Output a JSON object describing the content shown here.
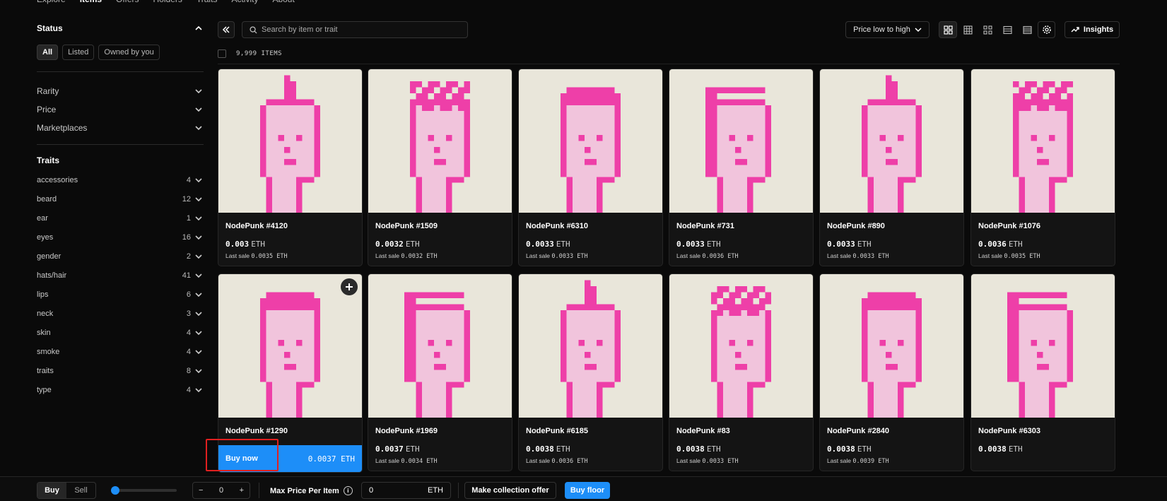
{
  "nav": {
    "tabs": [
      "Explore",
      "Items",
      "Offers",
      "Holders",
      "Traits",
      "Activity",
      "About"
    ],
    "active": "Items"
  },
  "sidebar": {
    "status": {
      "title": "Status",
      "buttons": [
        "All",
        "Listed",
        "Owned by you"
      ],
      "active": "All"
    },
    "filters": [
      "Rarity",
      "Price",
      "Marketplaces"
    ],
    "traits_title": "Traits",
    "traits": [
      {
        "name": "accessories",
        "count": "4"
      },
      {
        "name": "beard",
        "count": "12"
      },
      {
        "name": "ear",
        "count": "1"
      },
      {
        "name": "eyes",
        "count": "16"
      },
      {
        "name": "gender",
        "count": "2"
      },
      {
        "name": "hats/hair",
        "count": "41"
      },
      {
        "name": "lips",
        "count": "6"
      },
      {
        "name": "neck",
        "count": "3"
      },
      {
        "name": "skin",
        "count": "4"
      },
      {
        "name": "smoke",
        "count": "4"
      },
      {
        "name": "traits",
        "count": "8"
      },
      {
        "name": "type",
        "count": "4"
      }
    ]
  },
  "toolbar": {
    "search_placeholder": "Search by item or trait",
    "sort_label": "Price low to high",
    "insights_label": "Insights",
    "item_count": "9,999 ITEMS",
    "view_icons": [
      "grid-large-icon",
      "grid-small-icon",
      "grid-compact-icon",
      "list-icon",
      "table-icon"
    ]
  },
  "items": [
    {
      "name": "NodePunk #4120",
      "price": "0.003",
      "unit": "ETH",
      "last_sale": "Last sale",
      "last_value": "0.0035 ETH"
    },
    {
      "name": "NodePunk #1509",
      "price": "0.0032",
      "unit": "ETH",
      "last_sale": "Last sale",
      "last_value": "0.0032 ETH"
    },
    {
      "name": "NodePunk #6310",
      "price": "0.0033",
      "unit": "ETH",
      "last_sale": "Last sale",
      "last_value": "0.0033 ETH"
    },
    {
      "name": "NodePunk #731",
      "price": "0.0033",
      "unit": "ETH",
      "last_sale": "Last sale",
      "last_value": "0.0036 ETH"
    },
    {
      "name": "NodePunk #890",
      "price": "0.0033",
      "unit": "ETH",
      "last_sale": "Last sale",
      "last_value": "0.0033 ETH"
    },
    {
      "name": "NodePunk #1076",
      "price": "0.0036",
      "unit": "ETH",
      "last_sale": "Last sale",
      "last_value": "0.0035 ETH"
    },
    {
      "name": "NodePunk #1290",
      "price": "0.0037",
      "unit": "ETH",
      "last_sale": "",
      "last_value": "",
      "buy_label": "Buy now",
      "buy_price": "0.0037 ETH"
    },
    {
      "name": "NodePunk #1969",
      "price": "0.0037",
      "unit": "ETH",
      "last_sale": "Last sale",
      "last_value": "0.0034 ETH"
    },
    {
      "name": "NodePunk #6185",
      "price": "0.0038",
      "unit": "ETH",
      "last_sale": "Last sale",
      "last_value": "0.0036 ETH"
    },
    {
      "name": "NodePunk #83",
      "price": "0.0038",
      "unit": "ETH",
      "last_sale": "Last sale",
      "last_value": "0.0033 ETH"
    },
    {
      "name": "NodePunk #2840",
      "price": "0.0038",
      "unit": "ETH",
      "last_sale": "Last sale",
      "last_value": "0.0039 ETH"
    },
    {
      "name": "NodePunk #6303",
      "price": "0.0038",
      "unit": "ETH",
      "last_sale": "",
      "last_value": ""
    }
  ],
  "bottombar": {
    "buy": "Buy",
    "sell": "Sell",
    "active": "Buy",
    "sweep_fraction": 0,
    "quantity": "0",
    "max_price_label": "Max Price Per Item",
    "max_price_value": "0",
    "currency": "ETH",
    "collection_offer": "Make collection offer",
    "buy_floor": "Buy floor"
  },
  "colors": {
    "accent": "#1d8ef8",
    "punk": "#ee3fa8",
    "punk_light": "#f1c4dc",
    "image_bg": "#e9e6da",
    "highlight": "#e02020"
  }
}
